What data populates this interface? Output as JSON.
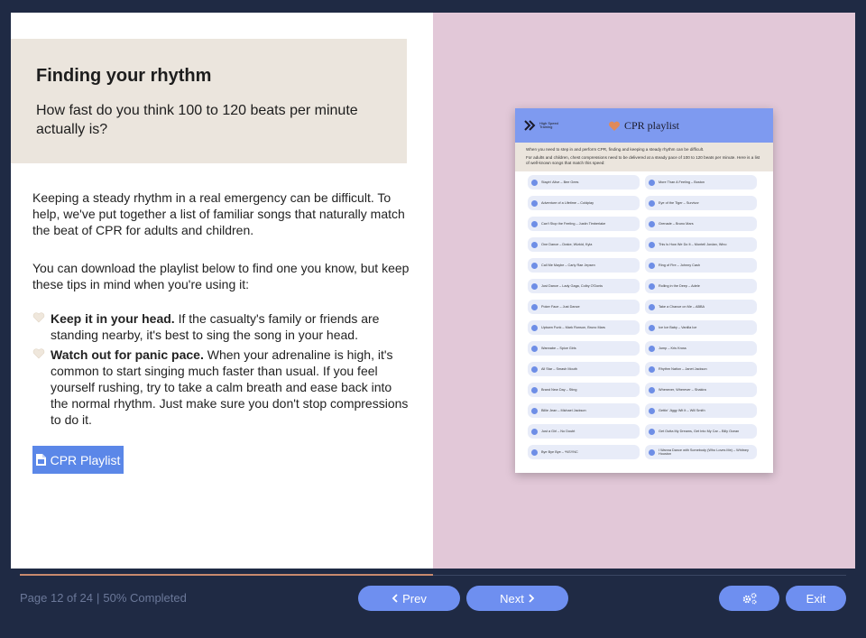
{
  "lesson": {
    "title": "Finding your rhythm",
    "question": "How fast do you think 100 to 120 beats per minute actually is?",
    "paragraph1": "Keeping a steady rhythm in a real emergency can be difficult. To help, we've put together a list of familiar songs that naturally match the beat of CPR for adults and children.",
    "paragraph2": "You can download the playlist below to find one you know, but keep these tips in mind when you're using it:",
    "tips": [
      {
        "bold": "Keep it in your head.",
        "text": " If the casualty's family or friends are standing nearby, it's best to sing the song in your head."
      },
      {
        "bold": "Watch out for panic pace.",
        "text": " When your adrenaline is high, it's common to start singing much faster than usual. If you feel yourself rushing, try to take a calm breath and ease back into the normal rhythm. Just make sure you don't stop compressions to do it."
      }
    ],
    "download_button": "CPR Playlist",
    "download_icon": "pdf-file-icon",
    "heart_icon": "heart-icon",
    "colors": {
      "accent": "#5b87e8",
      "header_bg": "#ebe5dd",
      "right_panel": "#e2c8d8"
    }
  },
  "playlist_doc": {
    "logo_text": "High Speed Training",
    "title": "CPR playlist",
    "intro1": "When you need to step in and perform CPR, finding and keeping a steady rhythm can be difficult.",
    "intro2": "For adults and children, chest compressions need to be delivered at a steady pace of 100 to 120 beats per minute. Here is a list of well-known songs that match this speed:",
    "songs_left": [
      "Stayin' Alive – Bee Gees",
      "Adventure of a Lifetime – Coldplay",
      "Can't Stop the Feeling – Justin Timberlake",
      "One Dance – Drake, Wizkid, Kyla",
      "Call Me Maybe – Carly Rae Jepsen",
      "Just Dance – Lady Gaga, Colby O'Donis",
      "Poker Face – Just Dance",
      "Uptown Funk – Mark Ronson, Bruno Mars",
      "Wannabe – Spice Girls",
      "All Star – Smash Mouth",
      "Brand New Day – Sting",
      "Billie Jean – Michael Jackson",
      "Just a Girl – No Doubt",
      "Bye Bye Bye – *NSYNC"
    ],
    "songs_right": [
      "More Than A Feeling – Boston",
      "Eye of the Tiger – Survivor",
      "Grenade – Bruno Mars",
      "This Is How We Do It – Montell Jordan, Wino",
      "Ring of Fire – Johnny Cash",
      "Rolling in the Deep – Adele",
      "Take a Chance on Me – ABBA",
      "Ice Ice Baby – Vanilla Ice",
      "Jump – Kris Kross",
      "Rhythm Nation – Janet Jackson",
      "Whenever, Wherever – Shakira",
      "Gettin' Jiggy Wit It – Will Smith",
      "Get Outta My Dreams, Get Into My Car – Billy Ocean",
      "I Wanna Dance with Somebody (Who Loves Me) – Whitney Houston"
    ]
  },
  "footer": {
    "page_text": "Page 12 of 24",
    "separator": "|",
    "completed_text": "50% Completed",
    "progress_fraction": 0.5,
    "prev_label": "Prev",
    "next_label": "Next",
    "exit_label": "Exit",
    "settings_icon": "gears-icon",
    "colors": {
      "button": "#6e8ff0",
      "background": "#1f2a44",
      "progress": "#c98a6e"
    }
  }
}
